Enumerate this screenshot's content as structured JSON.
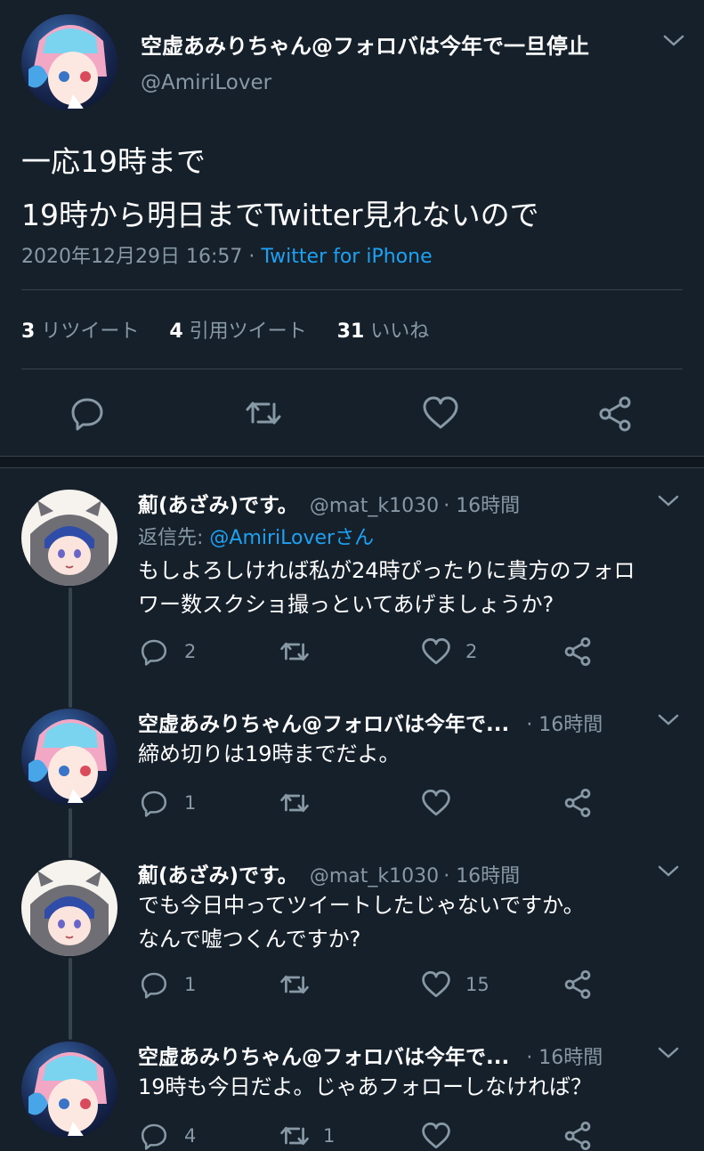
{
  "main_tweet": {
    "display_name": "空虚あみりちゃん@フォロバは今年で一旦停止",
    "handle": "@AmiriLover",
    "text_lines": [
      "一応19時まで",
      "19時から明日までTwitter見れないので"
    ],
    "timestamp": "2020年12月29日 16:57",
    "separator": "·",
    "source": "Twitter for iPhone",
    "stats": {
      "retweets_count": "3",
      "retweets_label": "リツイート",
      "quotes_count": "4",
      "quotes_label": "引用ツイート",
      "likes_count": "31",
      "likes_label": "いいね"
    }
  },
  "replies": [
    {
      "display_name": "薊(あざみ)です。",
      "handle": "@mat_k1030",
      "time": "· 16時間",
      "reply_to_prefix": "返信先: ",
      "reply_to_handle": "@AmiriLoverさん",
      "text_lines": [
        "もしよろしければ私が24時ぴったりに貴方のフォロ",
        "ワー数スクショ撮っといてあげましょうか?"
      ],
      "reply_count": "2",
      "retweet_count": "",
      "like_count": "2"
    },
    {
      "display_name": "空虚あみりちゃん@フォロバは今年で...",
      "handle": "",
      "time": "· 16時間",
      "text_lines": [
        "締め切りは19時までだよ。"
      ],
      "reply_count": "1",
      "retweet_count": "",
      "like_count": ""
    },
    {
      "display_name": "薊(あざみ)です。",
      "handle": "@mat_k1030",
      "time": "· 16時間",
      "text_lines": [
        "でも今日中ってツイートしたじゃないですか。",
        "なんで嘘つくんですか?"
      ],
      "reply_count": "1",
      "retweet_count": "",
      "like_count": "15"
    },
    {
      "display_name": "空虚あみりちゃん@フォロバは今年で...",
      "handle": "",
      "time": "· 16時間",
      "text_lines": [
        "19時も今日だよ。じゃあフォローしなければ？"
      ],
      "reply_count": "4",
      "retweet_count": "1",
      "like_count": ""
    }
  ],
  "colors": {
    "background": "#15202b",
    "muted": "#8899a6",
    "link": "#1da1f2",
    "divider": "#38444d"
  }
}
